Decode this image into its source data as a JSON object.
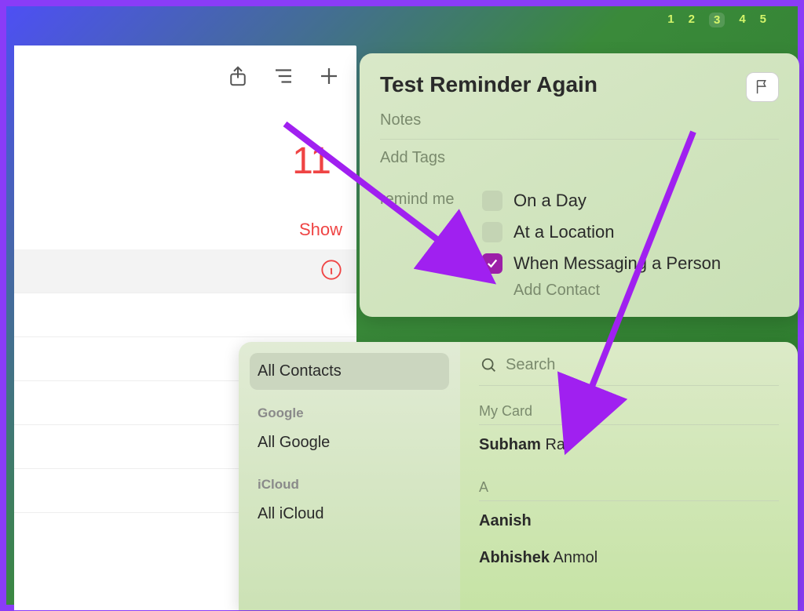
{
  "calendar_strip": [
    "1",
    "2",
    "3",
    "4",
    "5"
  ],
  "calendar_highlight_index": 2,
  "left": {
    "count": "11",
    "show_label": "Show"
  },
  "reminder": {
    "title": "Test Reminder Again",
    "notes_placeholder": "Notes",
    "tags_placeholder": "Add Tags",
    "remind_label": "remind me",
    "options": {
      "on_a_day": "On a Day",
      "at_a_location": "At a Location",
      "when_messaging": "When Messaging a Person"
    },
    "add_contact_label": "Add Contact"
  },
  "contacts": {
    "sidebar": {
      "all_contacts": "All Contacts",
      "section_google": "Google",
      "all_google": "All Google",
      "section_icloud": "iCloud",
      "all_icloud": "All iCloud"
    },
    "search_placeholder": "Search",
    "my_card_label": "My Card",
    "my_card_name_bold": "Subham",
    "my_card_name_rest": " Raj",
    "section_a": "A",
    "rows": {
      "aanish_bold": "Aanish",
      "abhishek_bold": "Abhishek",
      "abhishek_rest": " Anmol"
    }
  }
}
